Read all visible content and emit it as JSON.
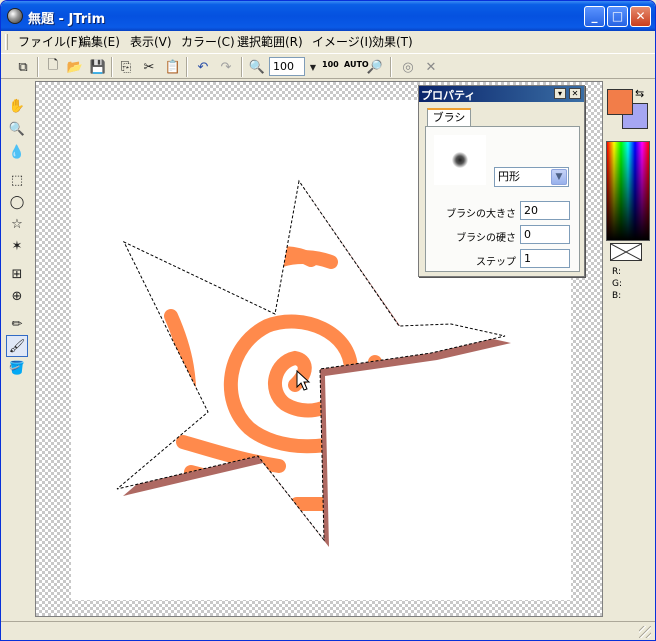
{
  "window": {
    "title": "無題 - JTrim"
  },
  "menu": [
    {
      "label": "ファイル(F)"
    },
    {
      "label": "編集(E)"
    },
    {
      "label": "表示(V)"
    },
    {
      "label": "カラー(C)"
    },
    {
      "label": "選択範囲(R)"
    },
    {
      "label": "イメージ(I)"
    },
    {
      "label": "効果(T)"
    }
  ],
  "toolbar": {
    "zoom_value": "100",
    "zoom_100_label": "100",
    "zoom_auto_label": "AUTO"
  },
  "properties_panel": {
    "title": "プロパティ",
    "tab": "ブラシ",
    "brush_shape": "円形",
    "brush_size_label": "ブラシの大きさ",
    "brush_size_value": "20",
    "brush_hardness_label": "ブラシの硬さ",
    "brush_hardness_value": "0",
    "step_label": "ステップ",
    "step_value": "1"
  },
  "colors": {
    "foreground": "#f27d49",
    "background": "#a6a6f2",
    "stroke": "#ff8a4c",
    "shadow": "#8b2a1f"
  },
  "color_readout": {
    "r_label": "R:",
    "g_label": "G:",
    "b_label": "B:"
  }
}
